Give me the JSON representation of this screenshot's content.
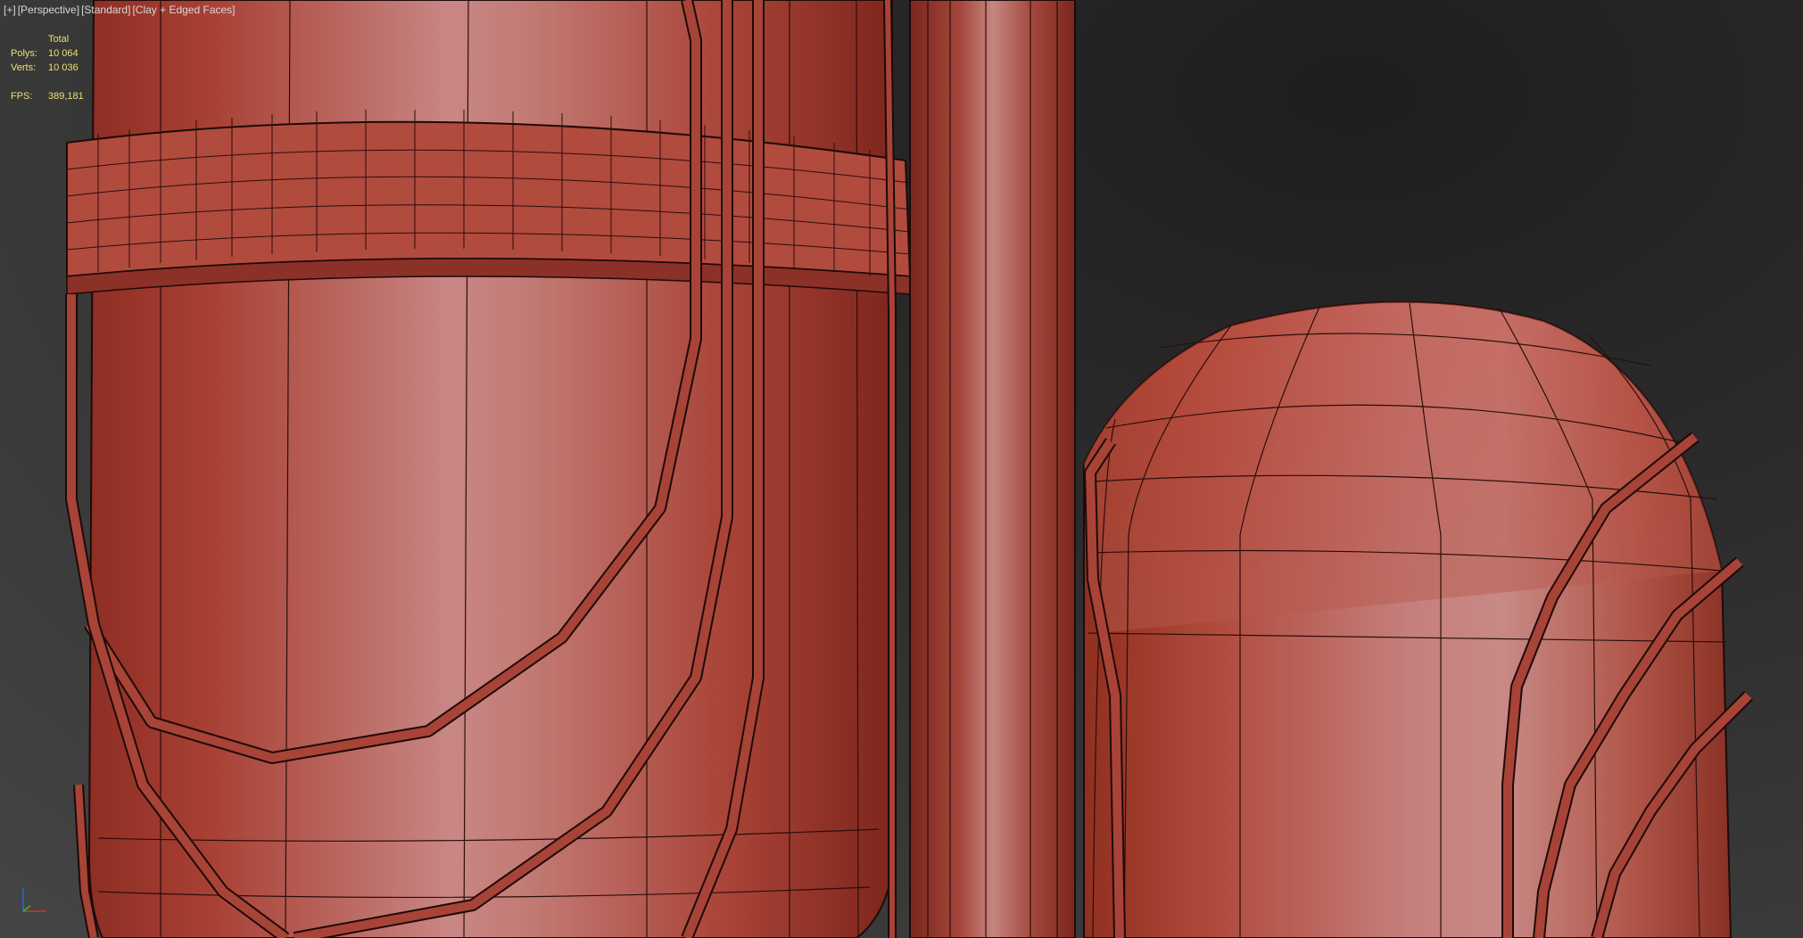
{
  "viewport": {
    "labels": [
      "[+]",
      "[Perspective]",
      "[Standard]",
      "[Clay + Edged Faces]"
    ]
  },
  "stats": {
    "header": "Total",
    "polys_label": "Polys:",
    "polys_value": "10 064",
    "verts_label": "Verts:",
    "verts_value": "10 036",
    "fps_label": "FPS:",
    "fps_value": "389,181"
  },
  "colors": {
    "clay": "#b5483d",
    "clay_highlight": "#c9807e",
    "wire": "#1e0a08",
    "stats_text": "#e8e070",
    "label_text": "#d8d8d8",
    "axis_x": "#d03030",
    "axis_y": "#30c030",
    "axis_z": "#3060e0"
  },
  "gizmo": {
    "icon": "axis-tripod-icon"
  }
}
